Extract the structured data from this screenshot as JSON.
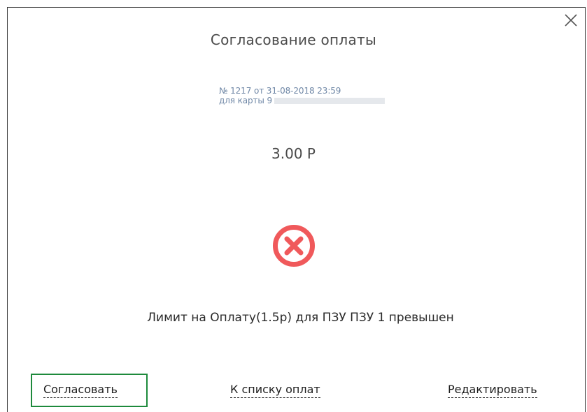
{
  "dialog": {
    "title": "Согласование оплаты",
    "close_icon": "close-icon",
    "payment": {
      "number_line": "№ 1217 от 31-08-2018 23:59",
      "card_label": "для карты",
      "card_prefix": "9"
    },
    "amount": "3.00 Р",
    "status_icon": "error-circle-icon",
    "status_color": "#f0595b",
    "message": "Лимит на Оплату(1.5р) для ПЗУ ПЗУ 1 превышен",
    "actions": {
      "approve": "Согласовать",
      "to_list": "К списку оплат",
      "edit": "Редактировать"
    },
    "highlight_color": "#1e8a3c"
  }
}
